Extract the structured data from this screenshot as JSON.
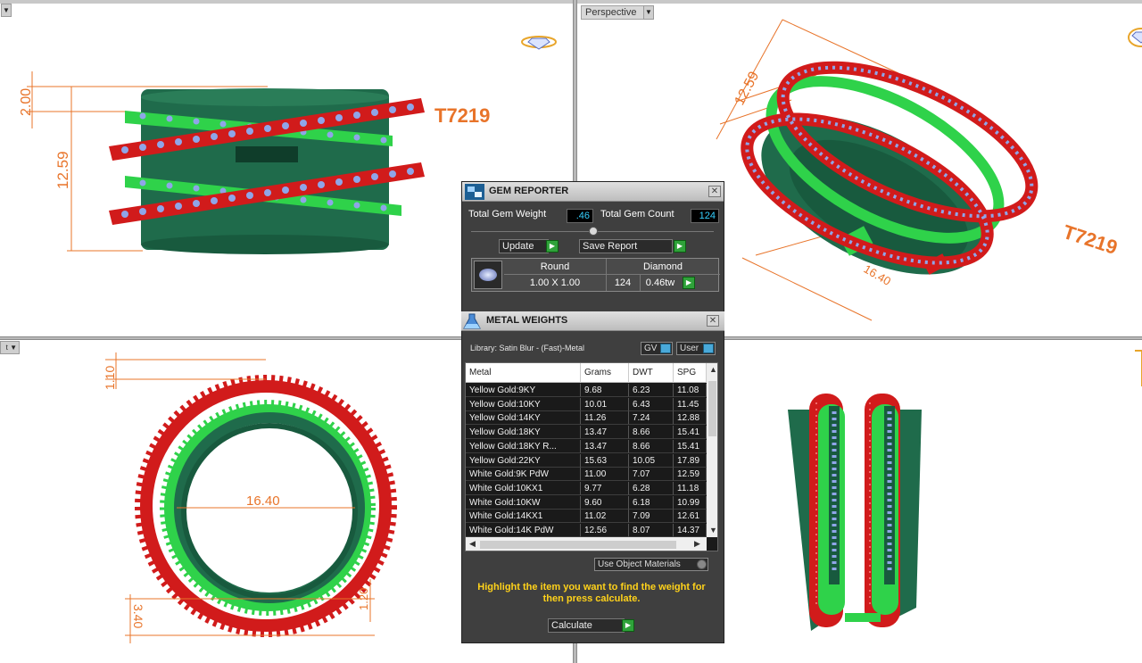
{
  "viewports": {
    "perspective_label": "Perspective",
    "top_left": {
      "dim_width": "2.00",
      "dim_height": "12.59",
      "model_tag": "T7219"
    },
    "top_right": {
      "dim_height": "12.59",
      "dim_length": "16.40",
      "model_tag": "T7219"
    },
    "bottom_left": {
      "dim_top": "1.10",
      "dim_inner": "16.40",
      "dim_bottom": "3.40",
      "dim_side": "1.20"
    }
  },
  "gem_reporter": {
    "title": "GEM REPORTER",
    "total_gem_weight_label": "Total Gem Weight",
    "total_gem_weight_value": ".46",
    "total_gem_count_label": "Total Gem Count",
    "total_gem_count_value": "124",
    "update_label": "Update",
    "save_report_label": "Save Report",
    "gem": {
      "cut": "Round",
      "size": "1.00 X 1.00",
      "stone": "Diamond",
      "count": "124",
      "weight": "0.46tw"
    }
  },
  "metal_weights": {
    "title": "METAL WEIGHTS",
    "library": "Library: Satin Blur - (Fast)-Metal",
    "gv_label": "GV",
    "user_label": "User",
    "columns": [
      "Metal",
      "Grams",
      "DWT",
      "SPG"
    ],
    "rows": [
      [
        "Yellow Gold:9KY",
        "9.68",
        "6.23",
        "11.08"
      ],
      [
        "Yellow Gold:10KY",
        "10.01",
        "6.43",
        "11.45"
      ],
      [
        "Yellow Gold:14KY",
        "11.26",
        "7.24",
        "12.88"
      ],
      [
        "Yellow Gold:18KY",
        "13.47",
        "8.66",
        "15.41"
      ],
      [
        "Yellow Gold:18KY R...",
        "13.47",
        "8.66",
        "15.41"
      ],
      [
        "Yellow Gold:22KY",
        "15.63",
        "10.05",
        "17.89"
      ],
      [
        "White Gold:9K PdW",
        "11.00",
        "7.07",
        "12.59"
      ],
      [
        "White Gold:10KX1",
        "9.77",
        "6.28",
        "11.18"
      ],
      [
        "White Gold:10KW",
        "9.60",
        "6.18",
        "10.99"
      ],
      [
        "White Gold:14KX1",
        "11.02",
        "7.09",
        "12.61"
      ],
      [
        "White Gold:14K PdW",
        "12.56",
        "8.07",
        "14.37"
      ]
    ],
    "use_object_materials_label": "Use Object Materials",
    "hint": "Highlight the item you want to find the weight for then press calculate.",
    "calculate_label": "Calculate"
  },
  "colors": {
    "band_dark": "#1f6b4b",
    "band_green": "#2fd24a",
    "band_red": "#d11b1b",
    "gem_blue": "#8fa5e8",
    "dimension": "#e8742a",
    "hint": "#ffd21a"
  }
}
